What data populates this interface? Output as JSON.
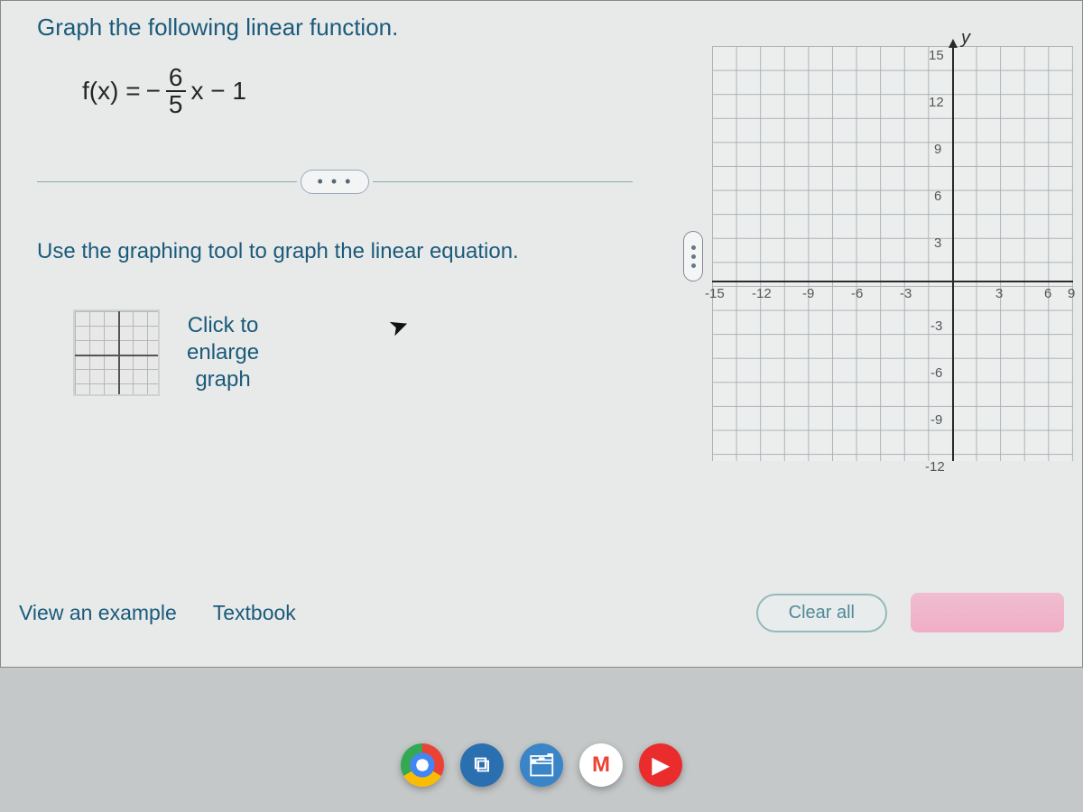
{
  "question": {
    "prompt": "Graph the following linear function.",
    "equation": {
      "lhs": "f(x) =",
      "neg": "−",
      "num": "6",
      "den": "5",
      "tail": "x − 1"
    },
    "ellipsis": "• • •",
    "instruction": "Use the graphing tool to graph the linear equation.",
    "enlarge": "Click to\nenlarge\ngraph"
  },
  "links": {
    "view_example": "View an example",
    "textbook": "Textbook"
  },
  "buttons": {
    "clear_all": "Clear all"
  },
  "chart_data": {
    "type": "line",
    "title": "",
    "xlabel": "",
    "ylabel": "y",
    "xlim": [
      -15,
      9
    ],
    "ylim": [
      -15,
      15
    ],
    "x_ticks": [
      -15,
      -12,
      -9,
      -6,
      -3,
      3,
      6,
      9
    ],
    "y_ticks": [
      15,
      12,
      9,
      6,
      3,
      -3,
      -6,
      -9,
      -12
    ],
    "grid": true,
    "series": []
  },
  "taskbar": {
    "items": [
      "chrome",
      "microsoft-store",
      "file-explorer",
      "gmail",
      "youtube"
    ]
  }
}
